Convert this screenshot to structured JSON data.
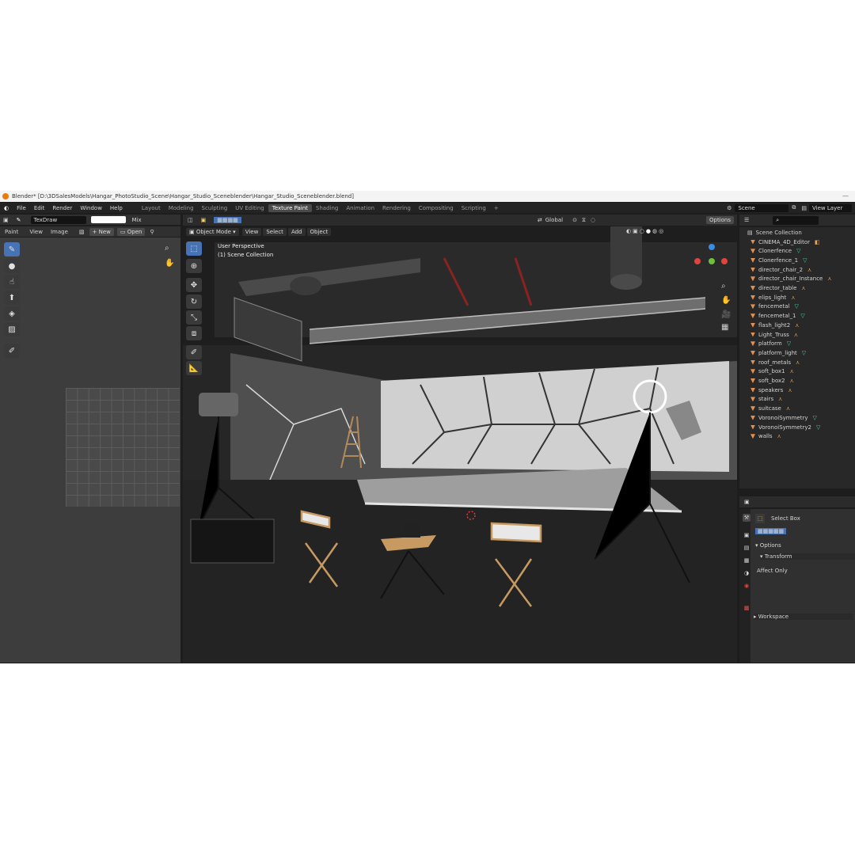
{
  "window": {
    "title": "Blender* [D:\\3DSalesModels\\Hangar_PhotoStudio_Scene\\Hangar_Studio_Sceneblender\\Hangar_Studio_Sceneblender.blend]",
    "controls": "—"
  },
  "menu": [
    "File",
    "Edit",
    "Render",
    "Window",
    "Help"
  ],
  "workspaces": [
    "Layout",
    "Modeling",
    "Sculpting",
    "UV Editing",
    "Texture Paint",
    "Shading",
    "Animation",
    "Rendering",
    "Compositing",
    "Scripting"
  ],
  "active_workspace": "Texture Paint",
  "add_workspace": "+",
  "scene": {
    "label": "Scene",
    "view_layer": "View Layer"
  },
  "image_editor": {
    "brush_name": "TexDraw",
    "blend": "Mix",
    "paint_menu": "Paint",
    "view_menu": "View",
    "image_menu": "Image",
    "new_label": "New",
    "open_label": "Open"
  },
  "viewport": {
    "mode": "Object Mode",
    "menus": [
      "View",
      "Select",
      "Add",
      "Object"
    ],
    "transform": "Global",
    "options": "Options",
    "overlay_line1": "User Perspective",
    "overlay_line2": "(1) Scene Collection"
  },
  "outliner": {
    "root": "Scene Collection",
    "items": [
      {
        "name": "CINEMA_4D_Editor",
        "type": "camera"
      },
      {
        "name": "Clonerfence",
        "type": "mesh"
      },
      {
        "name": "Clonerfence_1",
        "type": "mesh"
      },
      {
        "name": "director_chair_2",
        "type": "light"
      },
      {
        "name": "director_chair_Instance",
        "type": "light"
      },
      {
        "name": "director_table",
        "type": "light"
      },
      {
        "name": "elips_light",
        "type": "light"
      },
      {
        "name": "fencemetal",
        "type": "mesh"
      },
      {
        "name": "fencemetal_1",
        "type": "mesh"
      },
      {
        "name": "flash_light2",
        "type": "light"
      },
      {
        "name": "Light_Truss",
        "type": "light"
      },
      {
        "name": "platform",
        "type": "mesh"
      },
      {
        "name": "platform_light",
        "type": "mesh"
      },
      {
        "name": "roof_metals",
        "type": "light"
      },
      {
        "name": "soft_box1",
        "type": "light"
      },
      {
        "name": "soft_box2",
        "type": "light"
      },
      {
        "name": "speakers",
        "type": "light"
      },
      {
        "name": "stairs",
        "type": "light"
      },
      {
        "name": "suitcase",
        "type": "light"
      },
      {
        "name": "VoronoiSymmetry",
        "type": "mesh"
      },
      {
        "name": "VoronoiSymmetry2",
        "type": "mesh"
      },
      {
        "name": "walls",
        "type": "light"
      }
    ]
  },
  "properties": {
    "tool_name": "Select Box",
    "options_label": "Options",
    "transform_label": "Transform",
    "affect_only": "Affect Only",
    "workspace_label": "Workspace"
  },
  "colors": {
    "accent": "#4772b3",
    "panel": "#303030",
    "header": "#2b2b2b",
    "window_bg": "#1d1d1d"
  }
}
